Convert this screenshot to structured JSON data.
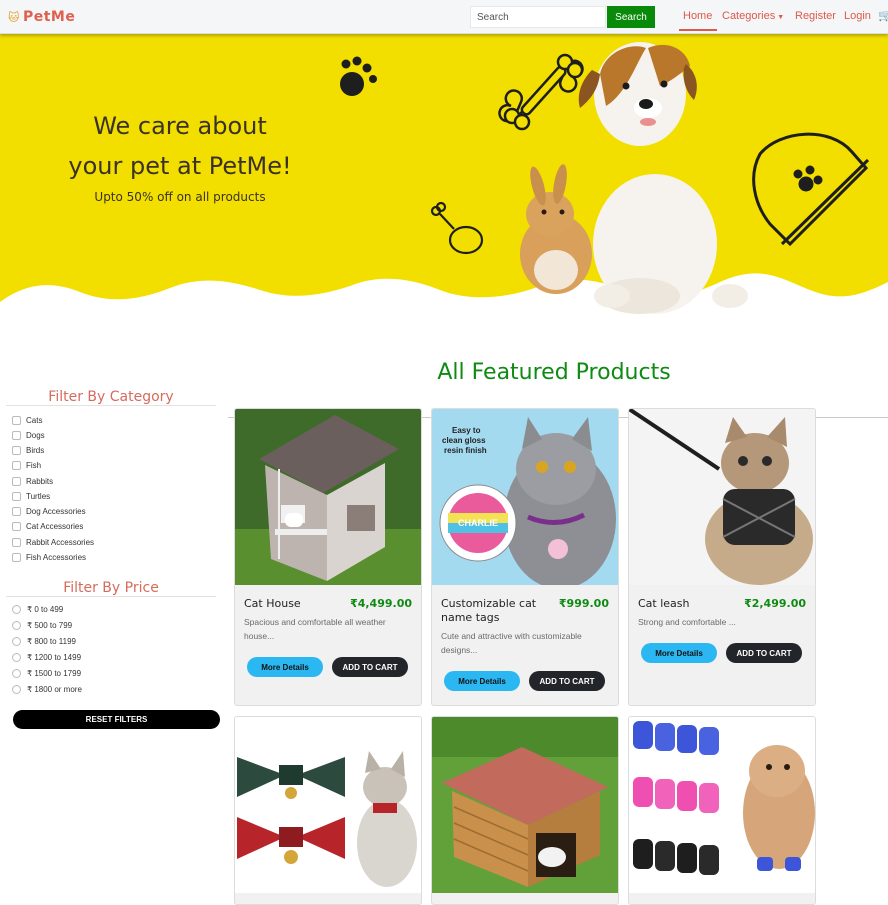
{
  "navbar": {
    "brand": "PetMe",
    "brand_icon": "cat-face-icon",
    "search_placeholder": "Search",
    "search_button": "Search",
    "links": {
      "home": "Home",
      "categories": "Categories",
      "register": "Register",
      "login": "Login"
    },
    "cart_icon": "cart-icon"
  },
  "hero": {
    "title_line1": "We care about",
    "title_line2": "your pet at PetMe!",
    "subtitle": "Upto 50% off on all products",
    "background": "#f2df00"
  },
  "sidebar": {
    "category_heading": "Filter By Category",
    "categories": [
      "Cats",
      "Dogs",
      "Birds",
      "Fish",
      "Rabbits",
      "Turtles",
      "Dog Accessories",
      "Cat Accessories",
      "Rabbit Accessories",
      "Fish Accessories"
    ],
    "price_heading": "Filter By Price",
    "prices": [
      "₹ 0 to 499",
      "₹ 500 to 799",
      "₹ 800 to 1199",
      "₹ 1200 to 1499",
      "₹ 1500 to 1799",
      "₹ 1800 or more"
    ],
    "reset_label": "RESET FILTERS"
  },
  "main": {
    "section_title": "All Featured Products",
    "details_label": "More Details",
    "cart_label": "ADD TO CART",
    "products": [
      {
        "name": "Cat House",
        "price": "₹4,499.00",
        "desc": "Spacious and comfortable all weather house..."
      },
      {
        "name": "Customizable cat name tags",
        "price": "₹999.00",
        "desc": "Cute and attractive with customizable designs..."
      },
      {
        "name": "Cat leash",
        "price": "₹2,499.00",
        "desc": "Strong and comfortable ..."
      }
    ]
  },
  "colors": {
    "accent": "#dc5a4a",
    "price_green": "#0f8a12",
    "details_blue": "#2bb8f2"
  }
}
